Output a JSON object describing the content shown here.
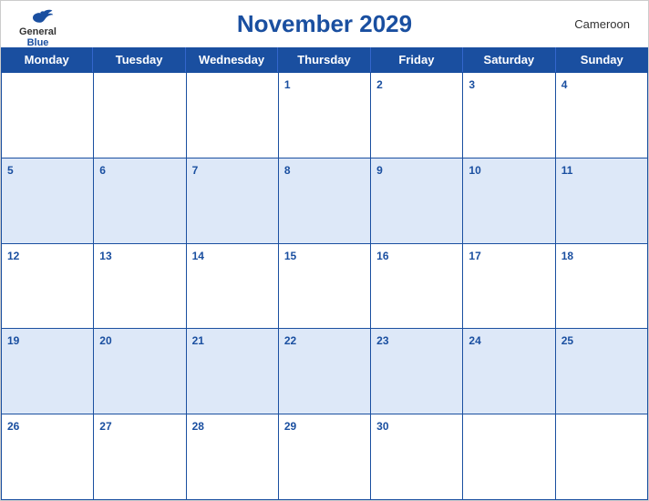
{
  "header": {
    "title": "November 2029",
    "country": "Cameroon",
    "logo_general": "General",
    "logo_blue": "Blue"
  },
  "days": [
    "Monday",
    "Tuesday",
    "Wednesday",
    "Thursday",
    "Friday",
    "Saturday",
    "Sunday"
  ],
  "weeks": [
    [
      null,
      null,
      null,
      1,
      2,
      3,
      4
    ],
    [
      5,
      6,
      7,
      8,
      9,
      10,
      11
    ],
    [
      12,
      13,
      14,
      15,
      16,
      17,
      18
    ],
    [
      19,
      20,
      21,
      22,
      23,
      24,
      25
    ],
    [
      26,
      27,
      28,
      29,
      30,
      null,
      null
    ]
  ],
  "colors": {
    "header_blue": "#1a4fa0",
    "row_blue_light": "#dde8f8",
    "white": "#ffffff"
  }
}
